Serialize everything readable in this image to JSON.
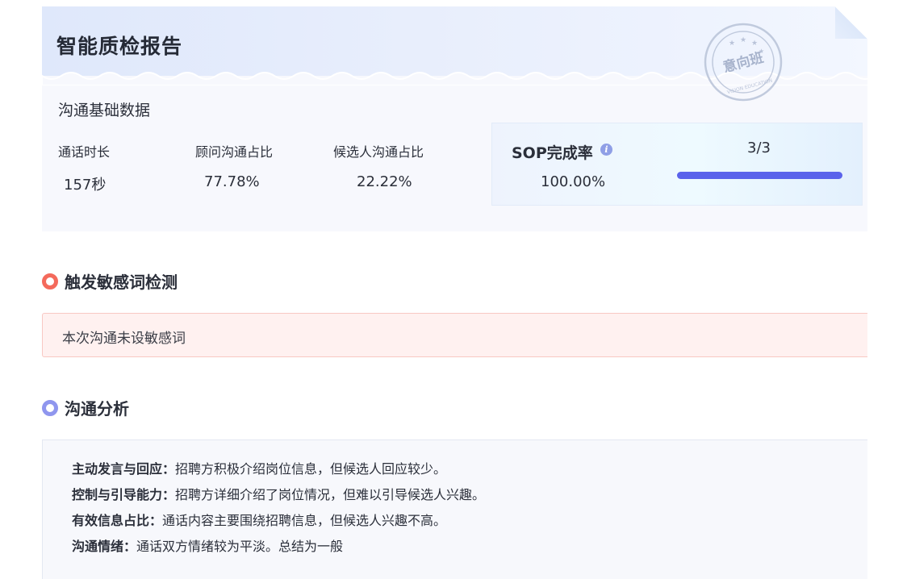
{
  "report": {
    "title": "智能质检报告",
    "stamp_text": "意向班",
    "stamp_subtext": "VISION EDUCATION"
  },
  "basic": {
    "section_label": "沟通基础数据",
    "metrics": [
      {
        "label": "通话时长",
        "value": "157秒"
      },
      {
        "label": "顾问沟通占比",
        "value": "77.78%"
      },
      {
        "label": "候选人沟通占比",
        "value": "22.22%"
      }
    ]
  },
  "sop": {
    "title": "SOP完成率",
    "info_icon": "info-icon",
    "rate": "100.00%",
    "fraction": "3/3",
    "progress": 1.0
  },
  "sensitive": {
    "heading": "触发敏感词检测",
    "message": "本次沟通未设敏感词",
    "icon_color": "#f46a5c"
  },
  "analysis": {
    "heading": "沟通分析",
    "icon_color": "#8f96ee",
    "items": [
      {
        "key": "主动发言与回应：",
        "text": "招聘方积极介绍岗位信息，但候选人回应较少。"
      },
      {
        "key": "控制与引导能力：",
        "text": "招聘方详细介绍了岗位情况，但难以引导候选人兴趣。"
      },
      {
        "key": "有效信息占比：",
        "text": "通话内容主要围绕招聘信息，但候选人兴趣不高。"
      },
      {
        "key": "沟通情绪：",
        "text": "通话双方情绪较为平淡。总结为一般"
      }
    ]
  },
  "colors": {
    "accent": "#5a63eb",
    "alert_bg": "#fff1f0"
  }
}
